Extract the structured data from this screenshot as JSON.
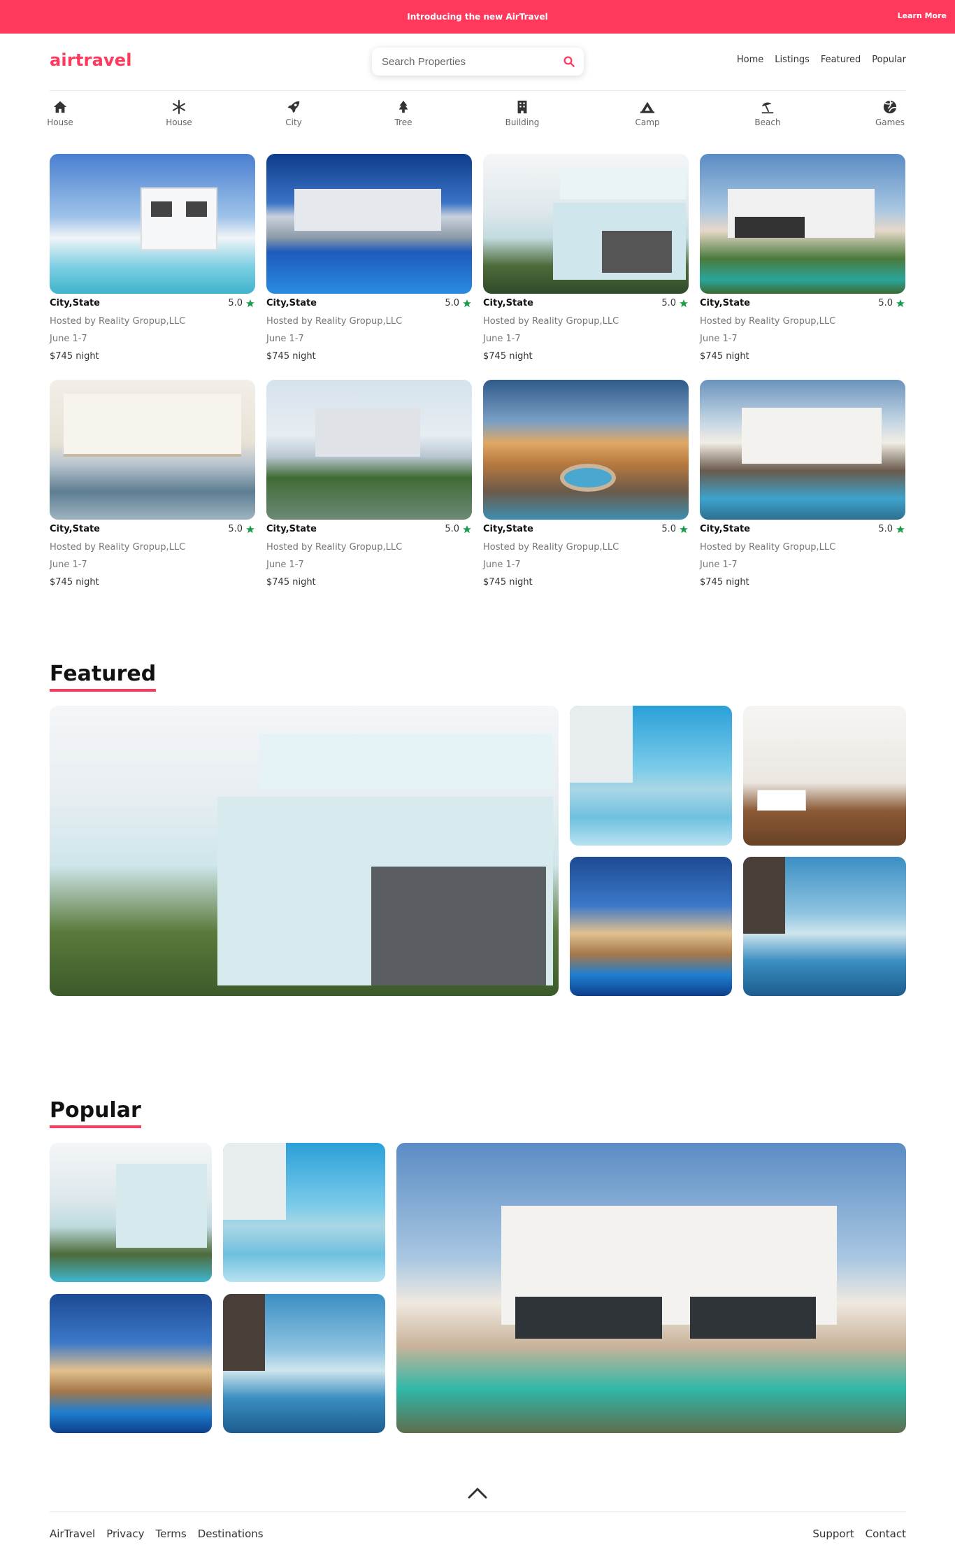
{
  "banner": {
    "text": "Introducing the new AirTravel",
    "learn_more": "Learn More",
    "color": "#ff385c"
  },
  "header": {
    "logo": "airtravel",
    "search_placeholder": "Search Properties",
    "nav": [
      "Home",
      "Listings",
      "Featured",
      "Popular"
    ]
  },
  "categories": [
    {
      "label": "House",
      "icon": "home-icon"
    },
    {
      "label": "House",
      "icon": "snowflake-icon"
    },
    {
      "label": "City",
      "icon": "rocket-icon"
    },
    {
      "label": "Tree",
      "icon": "tree-icon"
    },
    {
      "label": "Building",
      "icon": "building-icon"
    },
    {
      "label": "Camp",
      "icon": "campground-icon"
    },
    {
      "label": "Beach",
      "icon": "umbrella-beach-icon"
    },
    {
      "label": "Games",
      "icon": "volleyball-icon"
    }
  ],
  "listings": [
    {
      "title": "City,State",
      "rating": "5.0",
      "host": "Hosted by Reality Gropup,LLC",
      "dates": "June 1-7",
      "price": "$745 night"
    },
    {
      "title": "City,State",
      "rating": "5.0",
      "host": "Hosted by Reality Gropup,LLC",
      "dates": "June 1-7",
      "price": "$745 night"
    },
    {
      "title": "City,State",
      "rating": "5.0",
      "host": "Hosted by Reality Gropup,LLC",
      "dates": "June 1-7",
      "price": "$745 night"
    },
    {
      "title": "City,State",
      "rating": "5.0",
      "host": "Hosted by Reality Gropup,LLC",
      "dates": "June 1-7",
      "price": "$745 night"
    },
    {
      "title": "City,State",
      "rating": "5.0",
      "host": "Hosted by Reality Gropup,LLC",
      "dates": "June 1-7",
      "price": "$745 night"
    },
    {
      "title": "City,State",
      "rating": "5.0",
      "host": "Hosted by Reality Gropup,LLC",
      "dates": "June 1-7",
      "price": "$745 night"
    },
    {
      "title": "City,State",
      "rating": "5.0",
      "host": "Hosted by Reality Gropup,LLC",
      "dates": "June 1-7",
      "price": "$745 night"
    },
    {
      "title": "City,State",
      "rating": "5.0",
      "host": "Hosted by Reality Gropup,LLC",
      "dates": "June 1-7",
      "price": "$745 night"
    }
  ],
  "featured": {
    "title": "Featured"
  },
  "popular": {
    "title": "Popular"
  },
  "footer": {
    "left": [
      "AirTravel",
      "Privacy",
      "Terms",
      "Destinations"
    ],
    "right": [
      "Support",
      "Contact"
    ]
  },
  "colors": {
    "accent": "#ff385c",
    "star": "#1a9c4b"
  }
}
